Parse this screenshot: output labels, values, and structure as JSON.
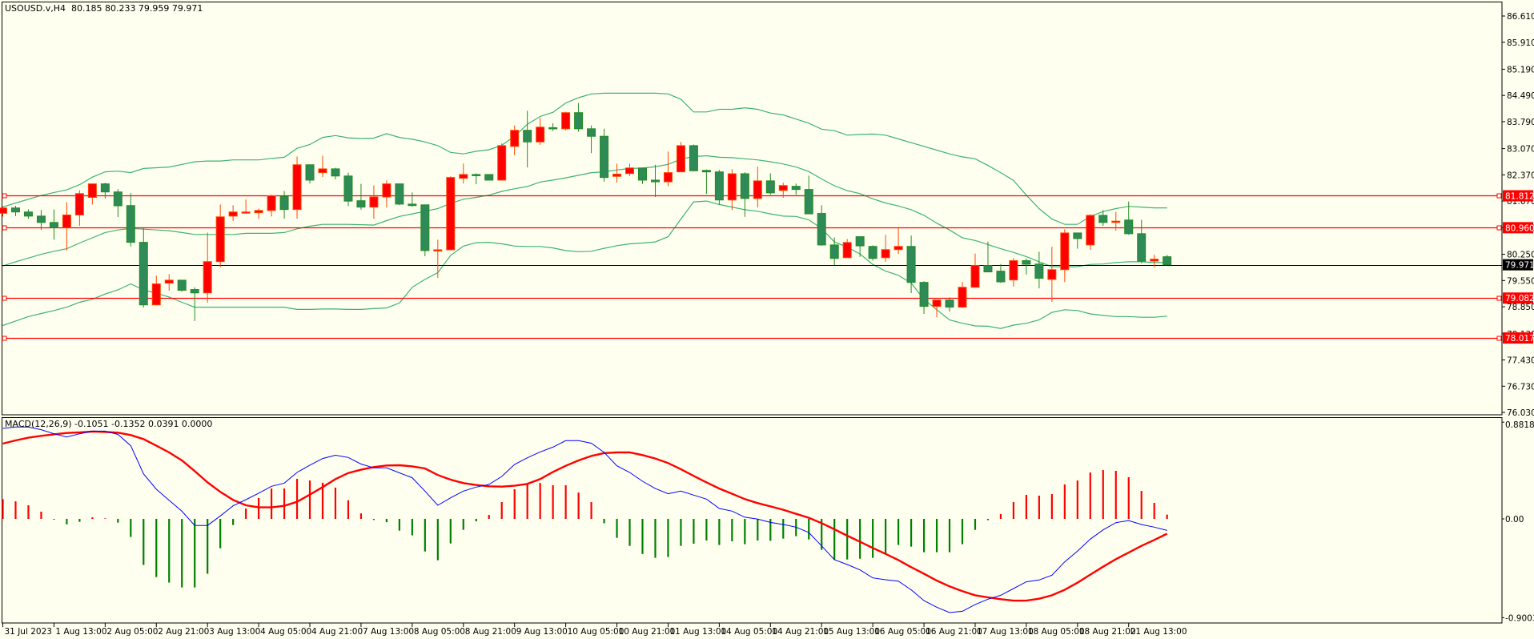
{
  "header": {
    "symbol_info": "USOUSD.v,H4  80.185 80.233 79.959 79.971"
  },
  "macd_header": {
    "label": "MACD(12,26,9) -0.1051 -0.1352 0.0391 0.0000"
  },
  "colors": {
    "background": "#FFFFF0",
    "bull_body": "#FF0000",
    "bull_outline": "#FF4500",
    "bear_body": "#2E8B57",
    "bear_outline": "#228B22",
    "bands": "#3CB371",
    "level_line": "#FF0000",
    "bid_line": "#000000",
    "macd_main": "#0000FF",
    "macd_signal": "#FF0000",
    "hist_pos": "#FF0000",
    "hist_neg": "#008000"
  },
  "chart_data": [
    {
      "type": "candlestick",
      "title": "USOUSD.v,H4",
      "ylim": [
        76.03,
        86.61
      ],
      "price_axis_labels": [
        "86.610",
        "85.910",
        "85.190",
        "84.490",
        "83.790",
        "83.070",
        "82.370",
        "81.670",
        "80.960",
        "80.250",
        "79.550",
        "78.850",
        "78.130",
        "77.430",
        "76.730",
        "76.030"
      ],
      "time_axis_labels": [
        "31 Jul 2023",
        "1 Aug 13:00",
        "2 Aug 05:00",
        "2 Aug 21:00",
        "3 Aug 13:00",
        "4 Aug 05:00",
        "4 Aug 21:00",
        "7 Aug 13:00",
        "8 Aug 05:00",
        "8 Aug 21:00",
        "9 Aug 13:00",
        "10 Aug 05:00",
        "10 Aug 21:00",
        "11 Aug 13:00",
        "14 Aug 05:00",
        "14 Aug 21:00",
        "15 Aug 13:00",
        "16 Aug 05:00",
        "16 Aug 21:00",
        "17 Aug 13:00",
        "18 Aug 05:00",
        "18 Aug 21:00",
        "21 Aug 13:00"
      ],
      "time_label_every_n_bars": 4,
      "ohlc": [
        [
          81.345,
          81.53,
          81.26,
          81.487
        ],
        [
          81.487,
          81.545,
          81.27,
          81.38
        ],
        [
          81.38,
          81.45,
          81.2,
          81.27
        ],
        [
          81.27,
          81.43,
          80.9,
          81.1
        ],
        [
          81.1,
          81.45,
          80.64,
          80.96
        ],
        [
          80.96,
          81.64,
          80.35,
          81.3
        ],
        [
          81.3,
          81.96,
          81.01,
          81.87
        ],
        [
          81.77,
          82.13,
          81.58,
          82.13
        ],
        [
          82.13,
          82.16,
          81.74,
          81.915
        ],
        [
          81.915,
          81.99,
          81.245,
          81.545
        ],
        [
          81.55,
          81.88,
          80.455,
          80.57
        ],
        [
          80.57,
          80.97,
          78.83,
          78.9
        ],
        [
          78.9,
          79.68,
          78.9,
          79.46
        ],
        [
          79.48,
          79.72,
          79.28,
          79.56
        ],
        [
          79.56,
          79.56,
          79.25,
          79.29
        ],
        [
          79.31,
          79.37,
          78.47,
          79.22
        ],
        [
          79.22,
          80.83,
          78.96,
          80.055
        ],
        [
          80.055,
          81.58,
          79.9,
          81.25
        ],
        [
          81.27,
          81.56,
          81.14,
          81.38
        ],
        [
          81.36,
          81.71,
          81.33,
          81.38
        ],
        [
          81.36,
          81.47,
          81.2,
          81.42
        ],
        [
          81.42,
          81.84,
          81.26,
          81.81
        ],
        [
          81.795,
          81.94,
          81.2,
          81.445
        ],
        [
          81.445,
          82.86,
          81.2,
          82.64
        ],
        [
          82.64,
          82.64,
          82.14,
          82.23
        ],
        [
          82.43,
          82.88,
          82.31,
          82.53
        ],
        [
          82.53,
          82.56,
          82.25,
          82.34
        ],
        [
          82.34,
          82.43,
          81.54,
          81.67
        ],
        [
          81.68,
          82.13,
          81.44,
          81.51
        ],
        [
          81.51,
          82.09,
          81.2,
          81.78
        ],
        [
          81.78,
          82.22,
          81.5,
          82.13
        ],
        [
          82.13,
          82.13,
          81.56,
          81.59
        ],
        [
          81.59,
          81.9,
          81.52,
          81.55
        ],
        [
          81.57,
          81.57,
          80.2,
          80.35
        ],
        [
          80.36,
          80.64,
          79.62,
          80.37
        ],
        [
          80.37,
          82.33,
          80.37,
          82.3
        ],
        [
          82.28,
          82.67,
          82.14,
          82.38
        ],
        [
          82.38,
          82.41,
          82.12,
          82.36
        ],
        [
          82.38,
          82.38,
          82.23,
          82.23
        ],
        [
          82.23,
          83.21,
          82.23,
          83.15
        ],
        [
          83.13,
          83.69,
          82.89,
          83.56
        ],
        [
          83.56,
          84.08,
          82.57,
          83.25
        ],
        [
          83.25,
          83.89,
          83.17,
          83.645
        ],
        [
          83.63,
          83.75,
          83.54,
          83.6
        ],
        [
          83.6,
          84.05,
          83.56,
          84.03
        ],
        [
          84.03,
          84.29,
          83.52,
          83.6
        ],
        [
          83.6,
          83.69,
          82.95,
          83.4
        ],
        [
          83.4,
          83.6,
          82.19,
          82.3
        ],
        [
          82.33,
          82.67,
          82.16,
          82.39
        ],
        [
          82.405,
          82.67,
          82.34,
          82.555
        ],
        [
          82.555,
          82.555,
          82.13,
          82.23
        ],
        [
          82.23,
          82.64,
          81.78,
          82.185
        ],
        [
          82.185,
          82.99,
          82.07,
          82.43
        ],
        [
          82.45,
          83.25,
          82.45,
          83.15
        ],
        [
          83.15,
          83.18,
          82.46,
          82.48
        ],
        [
          82.49,
          82.51,
          81.86,
          82.45
        ],
        [
          82.45,
          82.5,
          81.57,
          81.7
        ],
        [
          81.7,
          82.52,
          81.43,
          82.4
        ],
        [
          82.4,
          82.44,
          81.25,
          81.74
        ],
        [
          81.74,
          82.59,
          81.5,
          82.21
        ],
        [
          82.21,
          82.41,
          81.84,
          81.89
        ],
        [
          81.955,
          82.16,
          81.76,
          82.085
        ],
        [
          82.065,
          82.135,
          81.84,
          81.98
        ],
        [
          81.98,
          82.35,
          81.32,
          81.33
        ],
        [
          81.34,
          81.56,
          80.48,
          80.5
        ],
        [
          80.5,
          80.7,
          79.96,
          80.14
        ],
        [
          80.16,
          80.66,
          80.16,
          80.565
        ],
        [
          80.72,
          80.72,
          80.18,
          80.475
        ],
        [
          80.46,
          80.49,
          80.08,
          80.14
        ],
        [
          80.16,
          80.77,
          80.05,
          80.375
        ],
        [
          80.375,
          80.95,
          80.26,
          80.46
        ],
        [
          80.46,
          80.75,
          79.215,
          79.5
        ],
        [
          79.5,
          79.53,
          78.66,
          78.86
        ],
        [
          78.86,
          79.03,
          78.57,
          79.03
        ],
        [
          79.03,
          79.1,
          78.72,
          78.84
        ],
        [
          78.84,
          79.51,
          78.82,
          79.37
        ],
        [
          79.37,
          80.27,
          79.37,
          79.95
        ],
        [
          79.95,
          80.59,
          79.78,
          79.78
        ],
        [
          79.8,
          79.99,
          79.49,
          79.515
        ],
        [
          79.565,
          80.15,
          79.39,
          80.08
        ],
        [
          80.08,
          80.14,
          79.71,
          79.985
        ],
        [
          79.99,
          80.32,
          79.34,
          79.61
        ],
        [
          79.58,
          80.45,
          78.98,
          79.84
        ],
        [
          79.84,
          80.92,
          79.51,
          80.82
        ],
        [
          80.82,
          80.82,
          80.4,
          80.67
        ],
        [
          80.5,
          81.32,
          80.37,
          81.29
        ],
        [
          81.29,
          81.43,
          81.01,
          81.1
        ],
        [
          81.1,
          81.385,
          80.88,
          81.135
        ],
        [
          81.165,
          81.66,
          80.77,
          80.8
        ],
        [
          80.8,
          81.17,
          80.01,
          80.07
        ],
        [
          80.07,
          80.24,
          79.9,
          80.12
        ],
        [
          80.185,
          80.233,
          79.959,
          79.971
        ]
      ],
      "bollinger": {
        "upper": [
          81.51,
          81.62,
          81.72,
          81.82,
          81.9,
          81.97,
          82.11,
          82.31,
          82.45,
          82.47,
          82.43,
          82.54,
          82.56,
          82.58,
          82.65,
          82.72,
          82.74,
          82.74,
          82.77,
          82.77,
          82.77,
          82.81,
          82.84,
          83.08,
          83.18,
          83.37,
          83.42,
          83.36,
          83.34,
          83.35,
          83.47,
          83.37,
          83.32,
          83.25,
          83.15,
          82.97,
          82.93,
          83.0,
          83.04,
          83.16,
          83.4,
          83.72,
          83.93,
          84.04,
          84.29,
          84.43,
          84.53,
          84.55,
          84.55,
          84.55,
          84.55,
          84.55,
          84.53,
          84.39,
          84.05,
          84.05,
          84.12,
          84.12,
          84.16,
          84.12,
          84.02,
          83.97,
          83.86,
          83.75,
          83.59,
          83.55,
          83.43,
          83.45,
          83.46,
          83.43,
          83.33,
          83.23,
          83.13,
          83.03,
          82.93,
          82.85,
          82.8,
          82.62,
          82.43,
          82.22,
          81.83,
          81.47,
          81.19,
          81.05,
          81.05,
          81.26,
          81.39,
          81.47,
          81.53,
          81.51,
          81.49,
          81.49
        ],
        "middle": [
          79.94,
          80.05,
          80.15,
          80.25,
          80.33,
          80.4,
          80.55,
          80.69,
          80.83,
          80.9,
          80.94,
          80.92,
          80.9,
          80.88,
          80.83,
          80.78,
          80.78,
          80.78,
          80.78,
          80.81,
          80.81,
          80.81,
          80.83,
          80.93,
          81.0,
          81.05,
          81.05,
          81.05,
          81.04,
          81.03,
          81.15,
          81.26,
          81.33,
          81.4,
          81.47,
          81.61,
          81.72,
          81.77,
          81.83,
          81.93,
          82.0,
          82.06,
          82.18,
          82.23,
          82.29,
          82.36,
          82.43,
          82.45,
          82.5,
          82.54,
          82.55,
          82.59,
          82.65,
          82.79,
          82.86,
          82.88,
          82.84,
          82.83,
          82.8,
          82.77,
          82.72,
          82.66,
          82.58,
          82.46,
          82.26,
          82.08,
          81.95,
          81.87,
          81.73,
          81.62,
          81.54,
          81.44,
          81.29,
          81.08,
          80.9,
          80.69,
          80.62,
          80.51,
          80.4,
          80.3,
          80.19,
          80.05,
          79.92,
          79.91,
          79.92,
          79.98,
          79.99,
          80.03,
          80.05,
          80.05,
          80.03,
          80.03
        ],
        "lower": [
          78.35,
          78.47,
          78.59,
          78.67,
          78.75,
          78.84,
          78.97,
          79.05,
          79.19,
          79.3,
          79.46,
          79.3,
          79.21,
          79.11,
          78.97,
          78.84,
          78.84,
          78.84,
          78.84,
          78.84,
          78.84,
          78.84,
          78.84,
          78.78,
          78.78,
          78.79,
          78.79,
          78.78,
          78.78,
          78.8,
          78.82,
          78.95,
          79.37,
          79.58,
          79.76,
          80.22,
          80.47,
          80.56,
          80.57,
          80.53,
          80.47,
          80.46,
          80.46,
          80.42,
          80.35,
          80.32,
          80.33,
          80.41,
          80.48,
          80.53,
          80.55,
          80.58,
          80.72,
          81.19,
          81.65,
          81.67,
          81.58,
          81.51,
          81.44,
          81.4,
          81.33,
          81.27,
          81.26,
          81.17,
          80.94,
          80.58,
          80.44,
          80.26,
          79.98,
          79.8,
          79.69,
          79.48,
          79.05,
          78.77,
          78.5,
          78.41,
          78.34,
          78.33,
          78.27,
          78.36,
          78.41,
          78.5,
          78.7,
          78.77,
          78.75,
          78.66,
          78.62,
          78.59,
          78.59,
          78.57,
          78.57,
          78.6
        ]
      },
      "levels": [
        {
          "price": 81.812,
          "label": "81.812"
        },
        {
          "price": 80.96,
          "label": "80.960"
        },
        {
          "price": 79.082,
          "label": "79.082"
        },
        {
          "price": 78.017,
          "label": "78.017"
        }
      ],
      "bid": {
        "price": 79.971,
        "label": "79.971"
      }
    },
    {
      "type": "macd",
      "title": "MACD(12,26,9)",
      "ylim": [
        -0.9003,
        0.8818
      ],
      "axis_labels": [
        {
          "value": 0.8818,
          "label": "0.8818"
        },
        {
          "value": 0,
          "label": "0.00"
        },
        {
          "value": -0.9003,
          "label": "-0.9003"
        }
      ],
      "histogram": [
        0.18,
        0.16,
        0.124,
        0.066,
        -0.007,
        -0.05,
        -0.027,
        0.015,
        0.005,
        -0.034,
        -0.165,
        -0.42,
        -0.53,
        -0.58,
        -0.625,
        -0.625,
        -0.5,
        -0.268,
        -0.056,
        0.095,
        0.19,
        0.277,
        0.277,
        0.365,
        0.35,
        0.33,
        0.285,
        0.17,
        0.05,
        -0.01,
        -0.03,
        -0.107,
        -0.15,
        -0.297,
        -0.377,
        -0.224,
        -0.1,
        -0.022,
        0.036,
        0.153,
        0.27,
        0.324,
        0.328,
        0.307,
        0.307,
        0.24,
        0.153,
        -0.04,
        -0.173,
        -0.246,
        -0.32,
        -0.355,
        -0.348,
        -0.246,
        -0.226,
        -0.197,
        -0.238,
        -0.204,
        -0.231,
        -0.197,
        -0.2,
        -0.18,
        -0.158,
        -0.187,
        -0.282,
        -0.372,
        -0.37,
        -0.363,
        -0.355,
        -0.314,
        -0.238,
        -0.253,
        -0.304,
        -0.304,
        -0.304,
        -0.231,
        -0.1,
        -0.012,
        0.044,
        0.153,
        0.219,
        0.212,
        0.226,
        0.314,
        0.35,
        0.423,
        0.445,
        0.438,
        0.38,
        0.255,
        0.146,
        0.0391
      ],
      "main": [
        0.825,
        0.837,
        0.837,
        0.813,
        0.776,
        0.747,
        0.776,
        0.8,
        0.8,
        0.77,
        0.667,
        0.41,
        0.27,
        0.17,
        0.07,
        -0.06,
        -0.06,
        0.027,
        0.119,
        0.175,
        0.234,
        0.297,
        0.326,
        0.423,
        0.49,
        0.55,
        0.58,
        0.56,
        0.5,
        0.465,
        0.465,
        0.42,
        0.375,
        0.253,
        0.124,
        0.192,
        0.253,
        0.29,
        0.314,
        0.387,
        0.496,
        0.557,
        0.61,
        0.654,
        0.713,
        0.713,
        0.69,
        0.606,
        0.484,
        0.423,
        0.343,
        0.277,
        0.229,
        0.253,
        0.217,
        0.18,
        0.095,
        0.071,
        0.015,
        -0.002,
        -0.032,
        -0.051,
        -0.075,
        -0.124,
        -0.246,
        -0.372,
        -0.416,
        -0.465,
        -0.538,
        -0.555,
        -0.567,
        -0.647,
        -0.745,
        -0.805,
        -0.854,
        -0.842,
        -0.78,
        -0.732,
        -0.696,
        -0.635,
        -0.574,
        -0.557,
        -0.513,
        -0.392,
        -0.294,
        -0.185,
        -0.1,
        -0.034,
        -0.015,
        -0.051,
        -0.075,
        -0.1051
      ],
      "signal": [
        0.686,
        0.715,
        0.74,
        0.757,
        0.771,
        0.783,
        0.788,
        0.796,
        0.793,
        0.786,
        0.764,
        0.727,
        0.667,
        0.606,
        0.533,
        0.436,
        0.333,
        0.246,
        0.173,
        0.124,
        0.105,
        0.105,
        0.119,
        0.156,
        0.221,
        0.29,
        0.363,
        0.418,
        0.448,
        0.472,
        0.487,
        0.489,
        0.479,
        0.46,
        0.4,
        0.358,
        0.326,
        0.309,
        0.297,
        0.294,
        0.302,
        0.319,
        0.363,
        0.428,
        0.484,
        0.533,
        0.574,
        0.6,
        0.606,
        0.606,
        0.582,
        0.55,
        0.509,
        0.453,
        0.392,
        0.333,
        0.277,
        0.229,
        0.18,
        0.144,
        0.114,
        0.083,
        0.046,
        0.01,
        -0.039,
        -0.095,
        -0.153,
        -0.209,
        -0.265,
        -0.319,
        -0.375,
        -0.44,
        -0.5,
        -0.562,
        -0.615,
        -0.659,
        -0.696,
        -0.715,
        -0.732,
        -0.745,
        -0.745,
        -0.728,
        -0.696,
        -0.647,
        -0.582,
        -0.508,
        -0.436,
        -0.367,
        -0.307,
        -0.246,
        -0.192,
        -0.1352
      ]
    }
  ]
}
